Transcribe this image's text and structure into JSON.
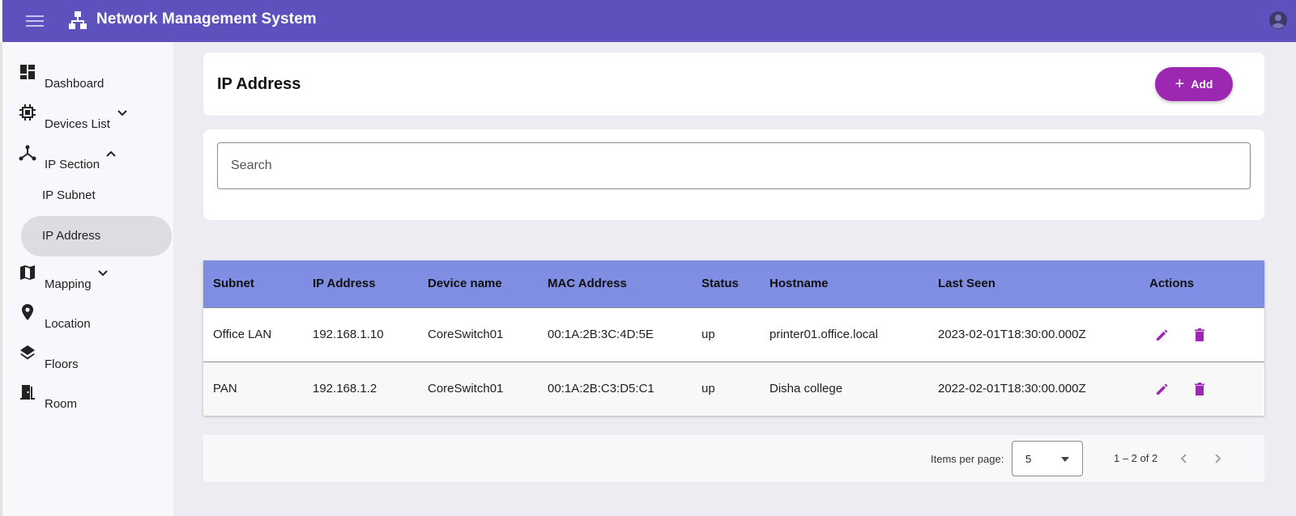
{
  "app": {
    "title": "Network Management System",
    "brand_color": "#5c51bd",
    "accent_color": "#9c27b0",
    "header_icons": [
      "menu-icon",
      "sitemap-icon",
      "account-circle-icon"
    ]
  },
  "sidebar": {
    "items": [
      {
        "label": "Dashboard",
        "icon": "dashboard-icon"
      },
      {
        "label": "Devices List",
        "icon": "chip-icon",
        "expand": "chevron-down-icon"
      },
      {
        "label": "IP Section",
        "icon": "hub-icon",
        "expand": "chevron-up-icon"
      },
      {
        "label": "Mapping",
        "icon": "map-icon",
        "expand": "chevron-down-icon"
      },
      {
        "label": "Location",
        "icon": "location-pin-icon"
      },
      {
        "label": "Floors",
        "icon": "layers-icon"
      },
      {
        "label": "Room",
        "icon": "door-icon"
      }
    ],
    "ip_section_children": [
      {
        "label": "IP Subnet",
        "active": false
      },
      {
        "label": "IP Address",
        "active": true
      }
    ]
  },
  "page": {
    "title": "IP Address",
    "add_label": "Add"
  },
  "search": {
    "placeholder": "Search",
    "value": ""
  },
  "table": {
    "header_color": "#7f8ee2",
    "columns": [
      "Subnet",
      "IP Address",
      "Device name",
      "MAC Address",
      "Status",
      "Hostname",
      "Last Seen",
      "Actions"
    ],
    "rows": [
      [
        "Office LAN",
        "192.168.1.10",
        "CoreSwitch01",
        "00:1A:2B:3C:4D:5E",
        "up",
        "printer01.office.local",
        "2023-02-01T18:30:00.000Z"
      ],
      [
        "PAN",
        "192.168.1.2",
        "CoreSwitch01",
        "00:1A:2B:C3:D5:C1",
        "up",
        "Disha college",
        "2022-02-01T18:30:00.000Z"
      ]
    ],
    "row_actions": [
      "edit-icon",
      "delete-icon"
    ]
  },
  "pagination": {
    "items_per_page_label": "Items per page:",
    "items_per_page": "5",
    "range": "1 – 2 of 2"
  }
}
